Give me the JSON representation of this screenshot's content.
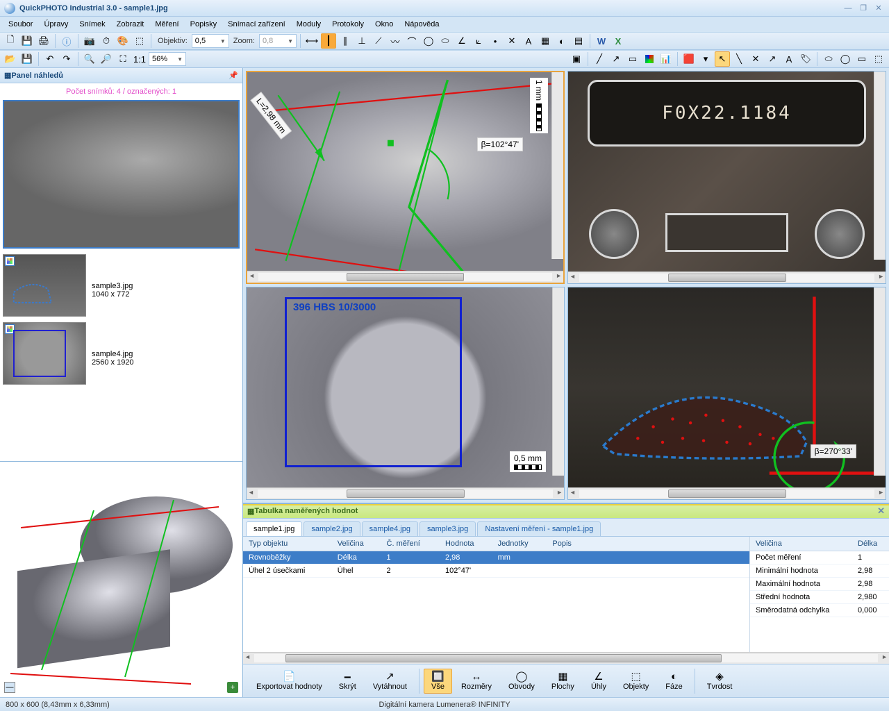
{
  "titlebar": {
    "title": "QuickPHOTO Industrial 3.0 - sample1.jpg"
  },
  "menu": [
    "Soubor",
    "Úpravy",
    "Snímek",
    "Zobrazit",
    "Měření",
    "Popisky",
    "Snímací zařízení",
    "Moduly",
    "Protokoly",
    "Okno",
    "Nápověda"
  ],
  "toolbar1": {
    "objektiv_label": "Objektiv:",
    "objektiv_value": "0,5",
    "zoom_label": "Zoom:",
    "zoom_value": "0,8"
  },
  "toolbar2": {
    "zoom_pct": "56%"
  },
  "thumbs": {
    "panel_title": "Panel náhledů",
    "status": "Počet snímků: 4 / označených: 1",
    "items": [
      {
        "name": "sample3.jpg",
        "dims": "1040 x 772"
      },
      {
        "name": "sample4.jpg",
        "dims": "2560 x 1920"
      }
    ]
  },
  "images": {
    "img1": {
      "len_label": "L=2,98 mm",
      "angle_label": "β=102°47'",
      "scale": "1 mm"
    },
    "img2": {
      "chip_text": "F0X22.1184"
    },
    "img3": {
      "hb_label": "396 HBS 10/3000",
      "scale": "0,5 mm"
    },
    "img4": {
      "angle_label": "β=270°33'"
    }
  },
  "meas": {
    "panel_title": "Tabulka naměřených hodnot",
    "tabs": [
      "sample1.jpg",
      "sample2.jpg",
      "sample4.jpg",
      "sample3.jpg",
      "Nastavení měření - sample1.jpg"
    ],
    "headers": [
      "Typ objektu",
      "Veličina",
      "Č. měření",
      "Hodnota",
      "Jednotky",
      "Popis"
    ],
    "rows": [
      {
        "typ": "Rovnoběžky",
        "vel": "Délka",
        "c": "1",
        "hod": "2,98",
        "jed": "mm",
        "pop": "",
        "sel": true
      },
      {
        "typ": "Úhel 2 úsečkami",
        "vel": "Úhel",
        "c": "2",
        "hod": "102°47'",
        "jed": "",
        "pop": "",
        "sel": false
      }
    ],
    "stats_hdr": {
      "vel": "Veličina",
      "val": "Délka"
    },
    "stats": [
      {
        "k": "Počet měření",
        "v": "1"
      },
      {
        "k": "Minimální hodnota",
        "v": "2,98"
      },
      {
        "k": "Maximální hodnota",
        "v": "2,98"
      },
      {
        "k": "Střední hodnota",
        "v": "2,980"
      },
      {
        "k": "Směrodatná odchylka",
        "v": "0,000"
      }
    ],
    "buttons": [
      {
        "label": "Exportovat hodnoty",
        "icon": "📄"
      },
      {
        "label": "Skrýt",
        "icon": "🗕"
      },
      {
        "label": "Vytáhnout",
        "icon": "↗"
      },
      {
        "sep": true
      },
      {
        "label": "Vše",
        "icon": "🔲",
        "active": true
      },
      {
        "label": "Rozměry",
        "icon": "↔"
      },
      {
        "label": "Obvody",
        "icon": "◯"
      },
      {
        "label": "Plochy",
        "icon": "▦"
      },
      {
        "label": "Úhly",
        "icon": "∠"
      },
      {
        "label": "Objekty",
        "icon": "⬚"
      },
      {
        "label": "Fáze",
        "icon": "◐"
      },
      {
        "sep": true
      },
      {
        "label": "Tvrdost",
        "icon": "◈"
      }
    ]
  },
  "statusbar": {
    "left": "800 x 600 (8,43mm x 6,33mm)",
    "center": "Digitální kamera Lumenera® INFINITY"
  }
}
